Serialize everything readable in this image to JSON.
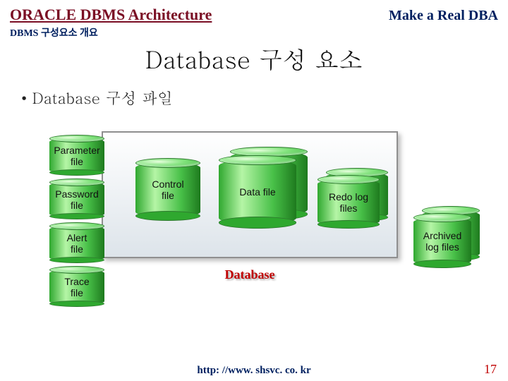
{
  "header": {
    "left": "ORACLE DBMS Architecture",
    "right": "Make a Real DBA",
    "sub": "DBMS 구성요소 개요"
  },
  "title": "Database 구성 요소",
  "bullet": "• Database 구성 파일",
  "cylinders": {
    "parameter": "Parameter\nfile",
    "password": "Password\nfile",
    "alert": "Alert\nfile",
    "trace": "Trace\nfile",
    "control": "Control\nfile",
    "data": "Data file",
    "redo": "Redo log\nfiles",
    "archived": "Archived\nlog files"
  },
  "db_box_label": "Database",
  "footer": {
    "url": "http: //www. shsvc. co. kr",
    "page": "17"
  }
}
